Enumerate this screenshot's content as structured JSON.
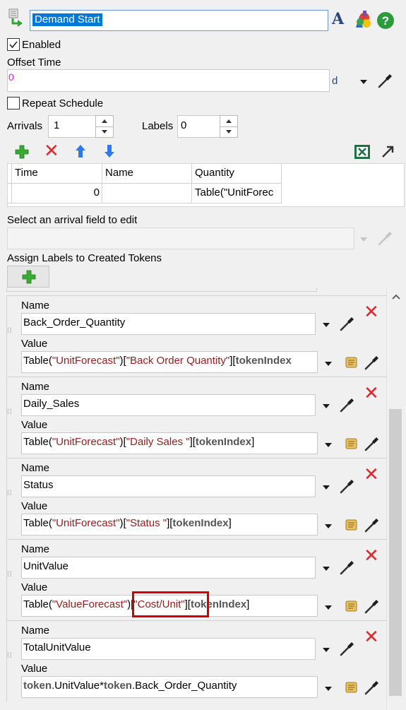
{
  "header": {
    "title_value": "Demand Start"
  },
  "enabled": {
    "label": "Enabled",
    "checked": true
  },
  "offset_time": {
    "label": "Offset Time",
    "value": "0",
    "unit": "d"
  },
  "repeat_schedule": {
    "label": "Repeat Schedule",
    "checked": false
  },
  "arrivals": {
    "label": "Arrivals",
    "value": "1"
  },
  "labels_count": {
    "label": "Labels",
    "value": "0"
  },
  "schedule_table": {
    "columns": [
      "Time",
      "Name",
      "Quantity"
    ],
    "rows": [
      {
        "time": "0",
        "name": "",
        "quantity": "Table(\"UnitForec"
      }
    ]
  },
  "arrival_field": {
    "label": "Select an arrival field to edit",
    "value": ""
  },
  "assign_labels": {
    "label": "Assign Labels to Created Tokens"
  },
  "label_cards": [
    {
      "name_label": "Name",
      "name": "Back_Order_Quantity",
      "value_label": "Value",
      "value_parts": [
        "Table(",
        "\"UnitForecast\"",
        ")[",
        "\"Back Order Quantity\"",
        "][",
        "tokenIndex"
      ]
    },
    {
      "name_label": "Name",
      "name": "Daily_Sales",
      "value_label": "Value",
      "value_parts": [
        "Table(",
        "\"UnitForecast\"",
        ")[",
        "\"Daily Sales \"",
        "][",
        "tokenIndex",
        "]"
      ]
    },
    {
      "name_label": "Name",
      "name": "Status",
      "value_label": "Value",
      "value_parts": [
        "Table(",
        "\"UnitForecast\"",
        ")[",
        "\"Status \"",
        "][",
        "tokenIndex",
        "]"
      ]
    },
    {
      "name_label": "Name",
      "name": "UnitValue",
      "value_label": "Value",
      "value_parts": [
        "Table(",
        "\"ValueForecast\"",
        ")[",
        "\"Cost/Unit\"",
        "][",
        "tokenIndex",
        "]"
      ]
    },
    {
      "name_label": "Name",
      "name": "TotalUnitValue",
      "value_label": "Value",
      "value_parts": [
        "token",
        ".UnitValue*",
        "token",
        ".Back_Order_Quantity"
      ]
    }
  ],
  "colors": {
    "accent_selection": "#0078d7",
    "add_green": "#3aa935",
    "delete_red": "#e0282c",
    "string_red": "#9a1b1b",
    "highlight_box": "#d40000",
    "help_green": "#2a9d3a"
  },
  "icons": {
    "header": [
      "source-icon",
      "font-icon",
      "color-palette-icon",
      "help-icon"
    ],
    "table_toolbar": [
      "add-icon",
      "delete-icon",
      "move-up-icon",
      "move-down-icon",
      "excel-icon",
      "expand-icon"
    ],
    "card_tools": [
      "dropdown-icon",
      "eyedropper-icon",
      "code-edit-icon",
      "delete-icon"
    ]
  }
}
